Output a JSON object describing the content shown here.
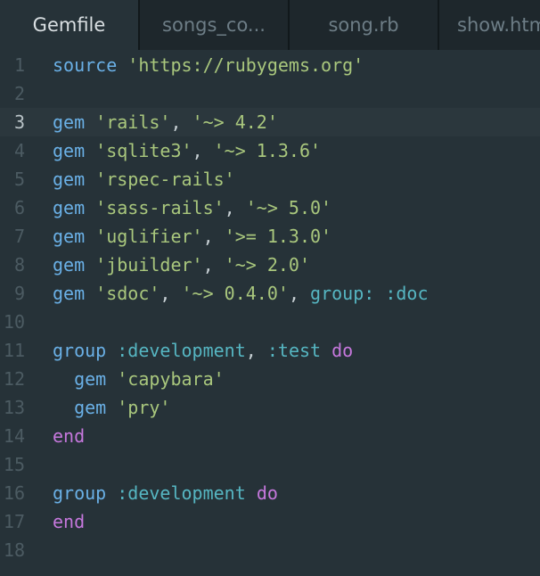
{
  "tabs": [
    {
      "label": "Gemfile",
      "active": true
    },
    {
      "label": "songs_co...",
      "active": false
    },
    {
      "label": "song.rb",
      "active": false
    },
    {
      "label": "show.htm",
      "active": false
    }
  ],
  "editor": {
    "current_line": 3,
    "lines": [
      {
        "number": "1",
        "tokens": [
          {
            "t": "source",
            "c": "keyword"
          },
          {
            "t": " ",
            "c": "plain"
          },
          {
            "t": "'https://rubygems.org'",
            "c": "string"
          }
        ]
      },
      {
        "number": "2",
        "tokens": []
      },
      {
        "number": "3",
        "tokens": [
          {
            "t": "gem",
            "c": "keyword"
          },
          {
            "t": " ",
            "c": "plain"
          },
          {
            "t": "'rails'",
            "c": "string"
          },
          {
            "t": ", ",
            "c": "plain"
          },
          {
            "t": "'~> 4.2'",
            "c": "string"
          }
        ]
      },
      {
        "number": "4",
        "tokens": [
          {
            "t": "gem",
            "c": "keyword"
          },
          {
            "t": " ",
            "c": "plain"
          },
          {
            "t": "'sqlite3'",
            "c": "string"
          },
          {
            "t": ", ",
            "c": "plain"
          },
          {
            "t": "'~> 1.3.6'",
            "c": "string"
          }
        ]
      },
      {
        "number": "5",
        "tokens": [
          {
            "t": "gem",
            "c": "keyword"
          },
          {
            "t": " ",
            "c": "plain"
          },
          {
            "t": "'rspec-rails'",
            "c": "string"
          }
        ]
      },
      {
        "number": "6",
        "tokens": [
          {
            "t": "gem",
            "c": "keyword"
          },
          {
            "t": " ",
            "c": "plain"
          },
          {
            "t": "'sass-rails'",
            "c": "string"
          },
          {
            "t": ", ",
            "c": "plain"
          },
          {
            "t": "'~> 5.0'",
            "c": "string"
          }
        ]
      },
      {
        "number": "7",
        "tokens": [
          {
            "t": "gem",
            "c": "keyword"
          },
          {
            "t": " ",
            "c": "plain"
          },
          {
            "t": "'uglifier'",
            "c": "string"
          },
          {
            "t": ", ",
            "c": "plain"
          },
          {
            "t": "'>= 1.3.0'",
            "c": "string"
          }
        ]
      },
      {
        "number": "8",
        "tokens": [
          {
            "t": "gem",
            "c": "keyword"
          },
          {
            "t": " ",
            "c": "plain"
          },
          {
            "t": "'jbuilder'",
            "c": "string"
          },
          {
            "t": ", ",
            "c": "plain"
          },
          {
            "t": "'~> 2.0'",
            "c": "string"
          }
        ]
      },
      {
        "number": "9",
        "tokens": [
          {
            "t": "gem",
            "c": "keyword"
          },
          {
            "t": " ",
            "c": "plain"
          },
          {
            "t": "'sdoc'",
            "c": "string"
          },
          {
            "t": ", ",
            "c": "plain"
          },
          {
            "t": "'~> 0.4.0'",
            "c": "string"
          },
          {
            "t": ", ",
            "c": "plain"
          },
          {
            "t": "group:",
            "c": "label"
          },
          {
            "t": " ",
            "c": "plain"
          },
          {
            "t": ":doc",
            "c": "symbol"
          }
        ]
      },
      {
        "number": "10",
        "tokens": []
      },
      {
        "number": "11",
        "tokens": [
          {
            "t": "group",
            "c": "keyword"
          },
          {
            "t": " ",
            "c": "plain"
          },
          {
            "t": ":development",
            "c": "symbol"
          },
          {
            "t": ", ",
            "c": "plain"
          },
          {
            "t": ":test",
            "c": "symbol"
          },
          {
            "t": " ",
            "c": "plain"
          },
          {
            "t": "do",
            "c": "control"
          }
        ]
      },
      {
        "number": "12",
        "tokens": [
          {
            "t": "  ",
            "c": "plain"
          },
          {
            "t": "gem",
            "c": "keyword"
          },
          {
            "t": " ",
            "c": "plain"
          },
          {
            "t": "'capybara'",
            "c": "string"
          }
        ]
      },
      {
        "number": "13",
        "tokens": [
          {
            "t": "  ",
            "c": "plain"
          },
          {
            "t": "gem",
            "c": "keyword"
          },
          {
            "t": " ",
            "c": "plain"
          },
          {
            "t": "'pry'",
            "c": "string"
          }
        ]
      },
      {
        "number": "14",
        "tokens": [
          {
            "t": "end",
            "c": "control"
          }
        ]
      },
      {
        "number": "15",
        "tokens": []
      },
      {
        "number": "16",
        "tokens": [
          {
            "t": "group",
            "c": "keyword"
          },
          {
            "t": " ",
            "c": "plain"
          },
          {
            "t": ":development",
            "c": "symbol"
          },
          {
            "t": " ",
            "c": "plain"
          },
          {
            "t": "do",
            "c": "control"
          }
        ]
      },
      {
        "number": "17",
        "tokens": [
          {
            "t": "end",
            "c": "control"
          }
        ]
      },
      {
        "number": "18",
        "tokens": []
      }
    ]
  },
  "colors": {
    "background": "#263238",
    "tabbar": "#1d262b",
    "keyword": "#6ab0e6",
    "string": "#a9c77d",
    "symbol": "#56b6c2",
    "control": "#c678dd",
    "line_number": "#4c5b62"
  }
}
